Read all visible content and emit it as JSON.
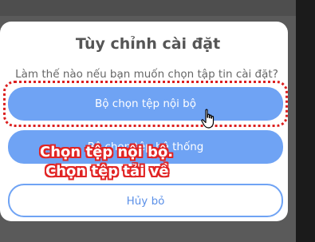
{
  "dialog": {
    "title": "Tùy chỉnh cài đặt",
    "message": "Làm thế nào nếu bạn muốn chọn tập tin cài đặt?",
    "buttons": {
      "internal": "Bộ chọn tệp nội bộ",
      "system": "Bộ chọn tệp hệ thống",
      "cancel": "Hủy bỏ"
    }
  },
  "annotations": {
    "line1": "Chọn tệp nội bộ.",
    "line2": "Chọn tệp tải về"
  },
  "colors": {
    "primary_button": "#6fa3f4",
    "highlight": "#dc1f1f",
    "overlay": "#5a5a5a"
  },
  "icons": {
    "cursor": "hand-pointer-icon"
  }
}
